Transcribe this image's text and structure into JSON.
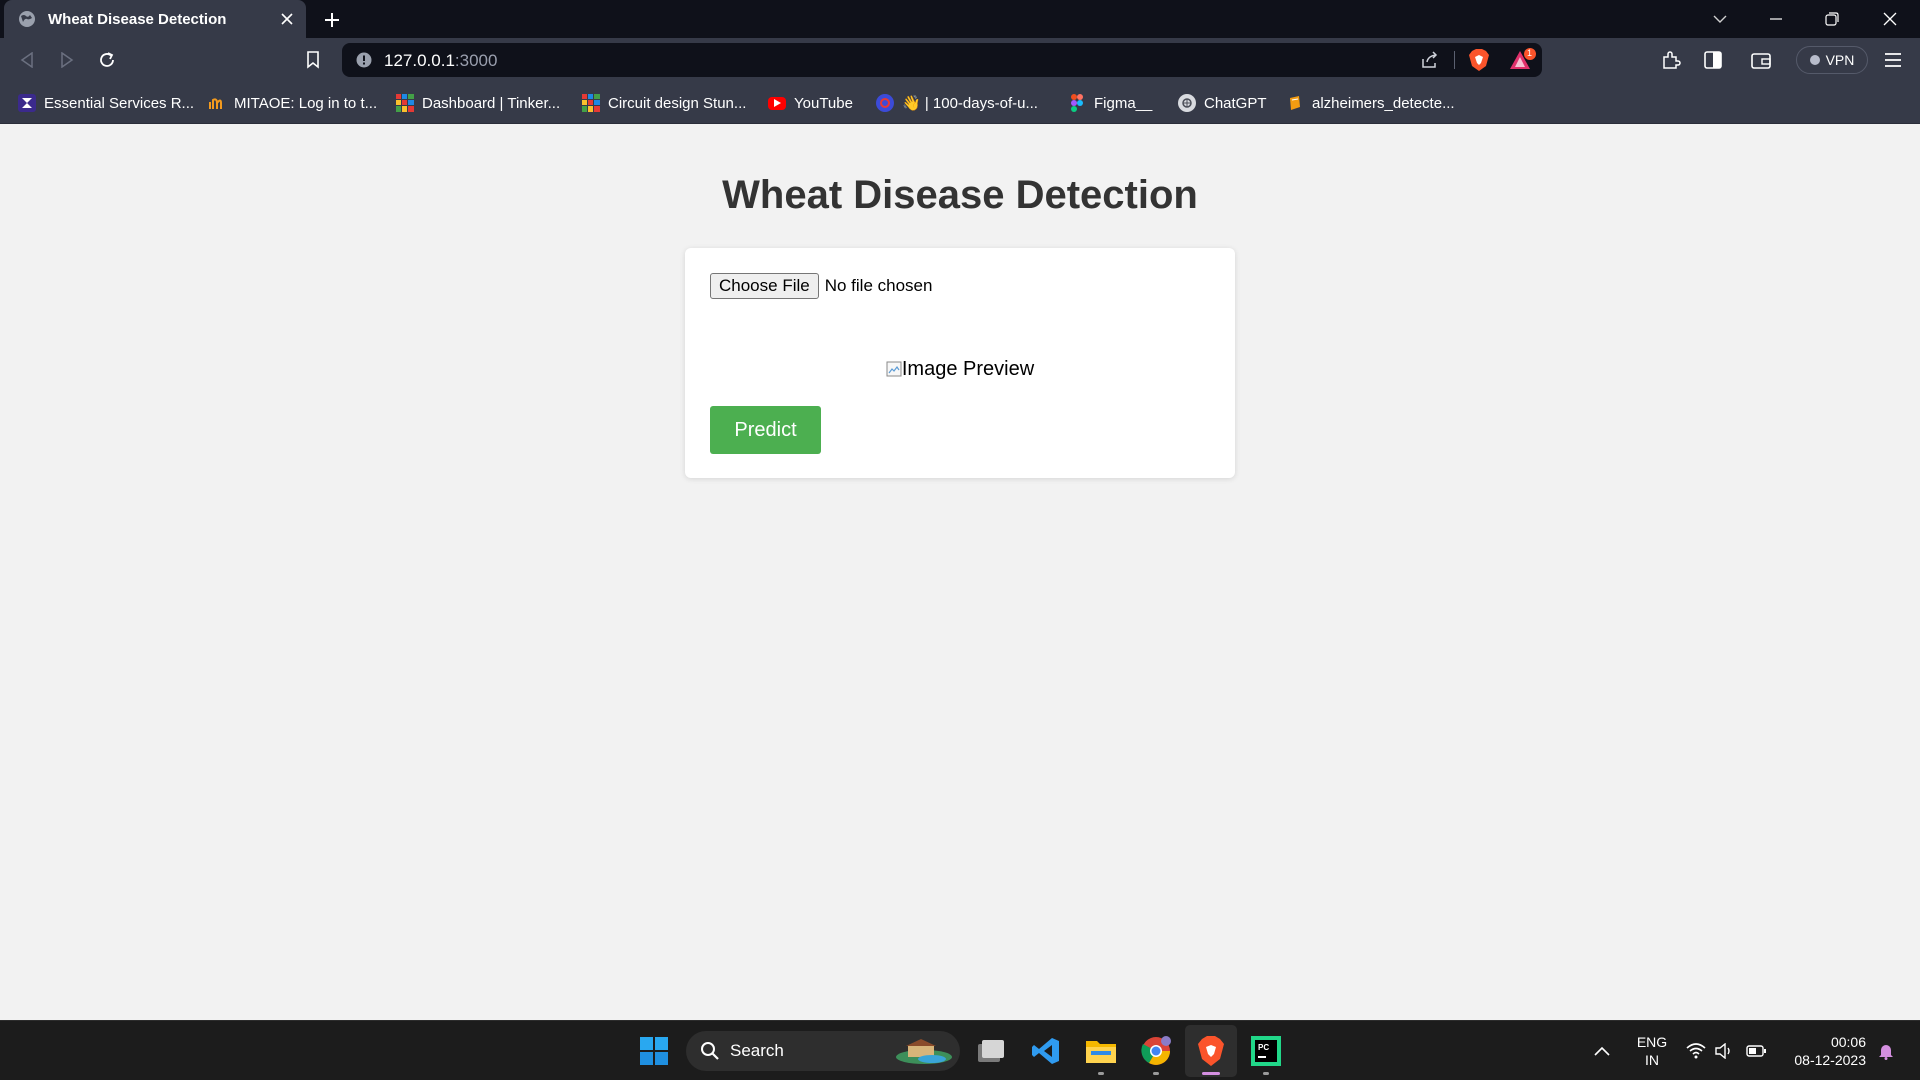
{
  "browser": {
    "tab": {
      "title": "Wheat Disease Detection"
    },
    "url": {
      "host": "127.0.0.1",
      "port": ":3000"
    },
    "vpn_label": "VPN",
    "rewards_badge": "1",
    "bookmarks": [
      {
        "label": "Essential Services R...",
        "icon": "essential-services-icon"
      },
      {
        "label": "MITAOE: Log in to t...",
        "icon": "mitaoe-icon"
      },
      {
        "label": "Dashboard | Tinker...",
        "icon": "tinkercad-icon"
      },
      {
        "label": "Circuit design Stun...",
        "icon": "tinkercad-icon"
      },
      {
        "label": "YouTube",
        "icon": "youtube-icon"
      },
      {
        "label": "👋 | 100-days-of-u...",
        "icon": "github-icon"
      },
      {
        "label": "Figma__",
        "icon": "figma-icon"
      },
      {
        "label": "ChatGPT",
        "icon": "chatgpt-icon"
      },
      {
        "label": "alzheimers_detecte...",
        "icon": "colab-icon"
      }
    ]
  },
  "page": {
    "heading": "Wheat Disease Detection",
    "file_input": {
      "button_label": "Choose File",
      "status": "No file chosen"
    },
    "image_preview_alt": "Image Preview",
    "predict_label": "Predict"
  },
  "taskbar": {
    "search_label": "Search",
    "language": {
      "line1": "ENG",
      "line2": "IN"
    },
    "time": "00:06",
    "date": "08-12-2023",
    "colors": {
      "accent_green": "#4caf50",
      "brave_orange": "#fb542b"
    }
  }
}
